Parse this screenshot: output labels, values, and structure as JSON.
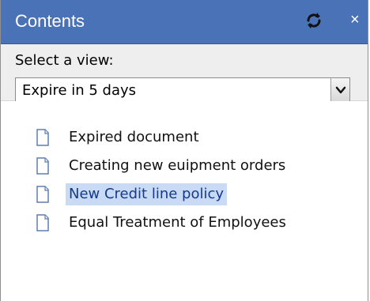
{
  "panel": {
    "title": "Contents",
    "refresh_icon": "refresh-icon",
    "close_icon": "close-icon",
    "close_glyph": "×"
  },
  "view": {
    "label": "Select a view:",
    "selected": "Expire in 5 days"
  },
  "documents": [
    {
      "label": "Expired document"
    },
    {
      "label": "Creating new euipment orders"
    },
    {
      "label": "New Credit line policy"
    },
    {
      "label": "Equal Treatment of Employees"
    }
  ],
  "colors": {
    "titlebar": "#4a73b7",
    "selection": "#c8daf4",
    "selected_text": "#163a8c"
  }
}
